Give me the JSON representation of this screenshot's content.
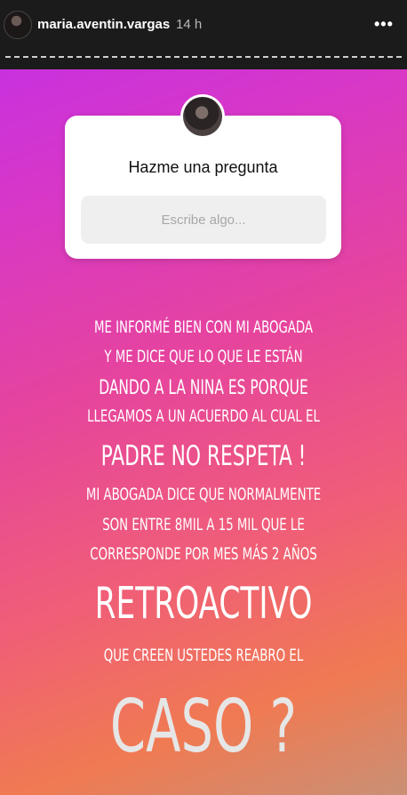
{
  "header": {
    "username": "maria.aventin.vargas",
    "time": "14 h",
    "more_icon": "•••"
  },
  "question_sticker": {
    "title": "Hazme una pregunta",
    "placeholder": "Escribe algo..."
  },
  "story_text": {
    "line1": "Me informé bien con mi abogada",
    "line2": "y me dice que lo que le están",
    "line3": "dando a la nina es porque",
    "line4": "llegamos a un acuerdo al cual el",
    "line5": "padre no respeta !",
    "line6": "Mi abogada dice que normalmente",
    "line7": "son entre 8mil a 15 mil que le",
    "line8": "corresponde por mes más 2 años",
    "line9": "retroactivo",
    "line10": "que creen ustedes reabro el",
    "line11": "caso ?"
  }
}
